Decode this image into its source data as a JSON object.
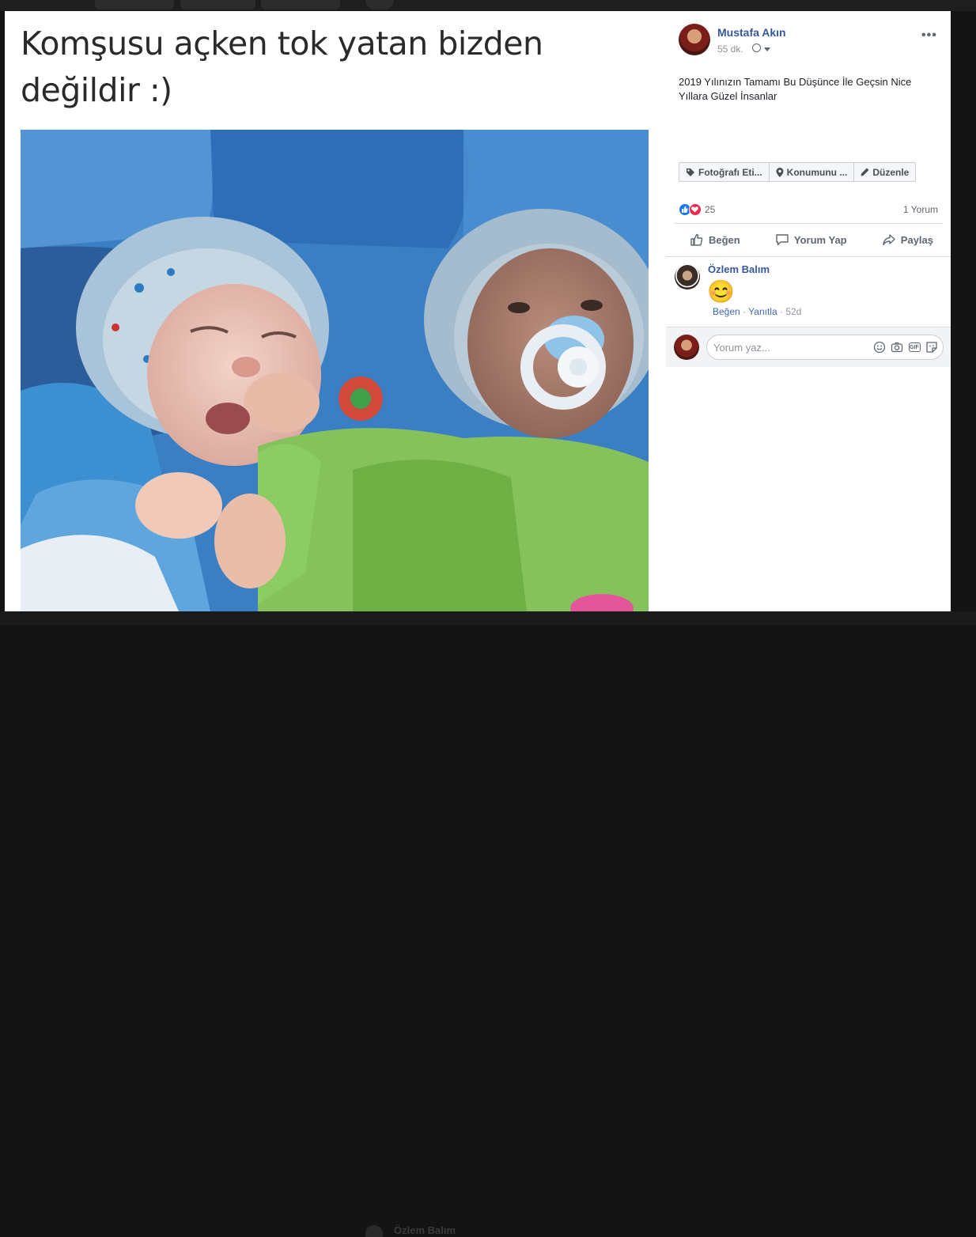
{
  "meme": {
    "caption_line1": "Komşusu açken tok yatan bizden",
    "caption_line2": "değildir :)"
  },
  "post": {
    "author": "Mustafa Akın",
    "time": "55 dk.",
    "text": "2019 Yılınızın Tamamı Bu Düşünce İle Geçsin Nice Yıllara Güzel İnsanlar",
    "more_icon": "•••"
  },
  "tag_bar": {
    "tag_photo": "Fotoğrafı Eti...",
    "tag_location": "Konumunu ...",
    "edit": "Düzenle"
  },
  "stats": {
    "reactions_count": "25",
    "comments_count": "1 Yorum"
  },
  "actions": {
    "like": "Beğen",
    "comment": "Yorum Yap",
    "share": "Paylaş"
  },
  "comments": [
    {
      "author": "Özlem Balım",
      "emoji": "😊",
      "like_link": "Beğen",
      "reply_link": "Yanıtla",
      "age": "52d"
    }
  ],
  "composer": {
    "placeholder": "Yorum yaz..."
  },
  "background": {
    "ghost_name": "Özlem Balım"
  },
  "colors": {
    "link_blue": "#365899",
    "like_blue": "#1877f2",
    "love_red": "#f0284a"
  }
}
